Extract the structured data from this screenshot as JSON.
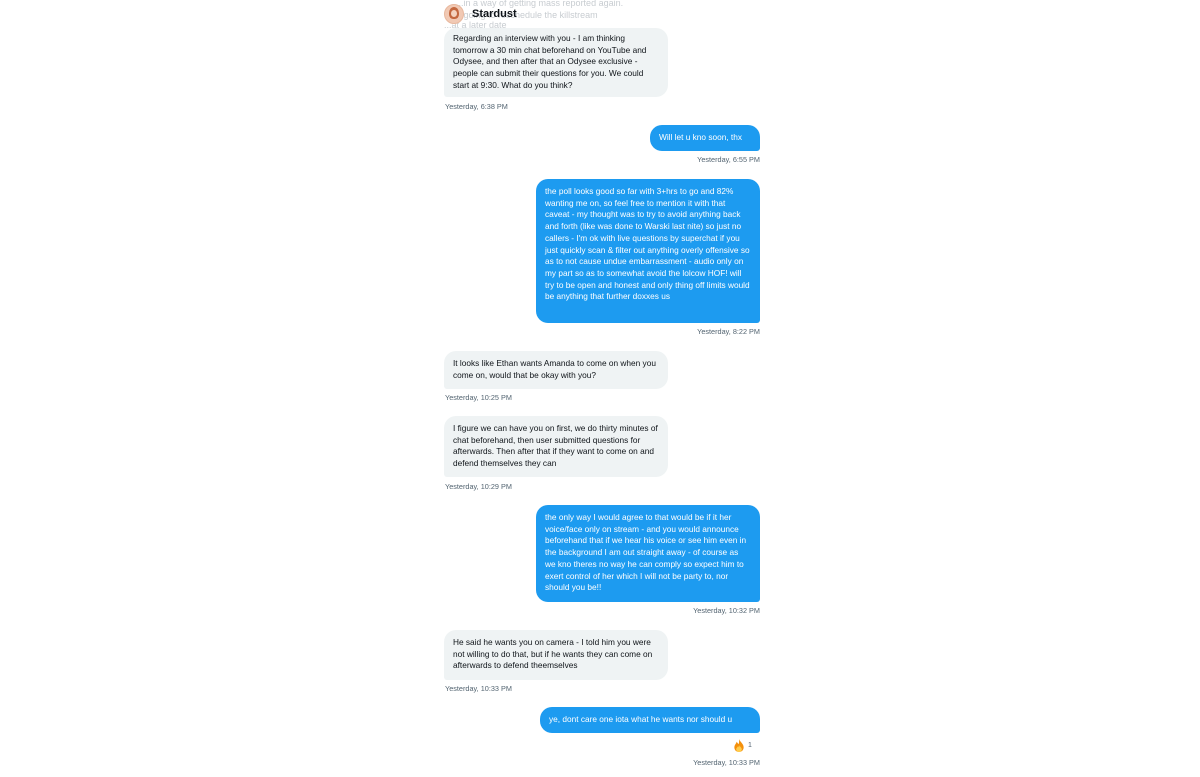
{
  "faded_lines": [
    "...in a way of getting mass reported again.",
    "...going to reschedule the killstream",
    "...at a later date"
  ],
  "header": {
    "name": "Stardust"
  },
  "messages": [
    {
      "dir": "in",
      "text": "Regarding an interview with you - I am thinking tomorrow a 30 min chat beforehand on YouTube and Odysee, and then after that an Odysee exclusive - people can submit their questions for you. We could start at 9:30. What do you think?",
      "time": "Yesterday, 6:38 PM"
    },
    {
      "dir": "out",
      "text": "Will let u kno soon, thx",
      "time": "Yesterday, 6:55 PM"
    },
    {
      "dir": "out",
      "text": "the poll looks good so far with 3+hrs to go and 82% wanting me on, so feel free to mention it with that caveat - my thought was to try to avoid anything back and forth (like was done to Warski last nite) so just no callers - I'm ok with live questions by superchat if you just quickly scan & filter out anything overly offensive so as to not cause undue embarrassment - audio only on my part so as to somewhat avoid the lolcow HOF!  will try to be open and honest and only thing off limits would be anything that further doxxes us",
      "time": "Yesterday, 8:22 PM"
    },
    {
      "dir": "in",
      "text": "It looks like Ethan wants Amanda to come on when you come on, would that be okay with you?",
      "time": "Yesterday, 10:25 PM"
    },
    {
      "dir": "in",
      "text": "I figure we can have you on first, we do thirty minutes of chat beforehand, then user submitted questions for afterwards. Then after that if they want to come on and defend themselves they can",
      "time": "Yesterday, 10:29 PM"
    },
    {
      "dir": "out",
      "text": "the only way I would agree to that would be if it her voice/face only on stream - and you would announce beforehand that if we hear his voice or see him even in the background I am out straight away - of course as we kno theres no way he can comply so expect him to exert control of her which I will not be party to, nor should you be!!",
      "time": "Yesterday, 10:32 PM"
    },
    {
      "dir": "in",
      "text": "He said he wants you on camera - I told him you were not willing to do that, but if he wants they can come on afterwards to defend theemselves",
      "time": "Yesterday, 10:33 PM"
    },
    {
      "dir": "out",
      "text": "ye, dont care one iota what he wants nor should u",
      "time": "Yesterday, 10:33 PM",
      "reaction": {
        "icon": "fire-emoji",
        "count": "1"
      }
    }
  ],
  "colors": {
    "outgoing": "#1d9bf0",
    "incoming": "#eff3f4",
    "timestamp": "#536471"
  }
}
